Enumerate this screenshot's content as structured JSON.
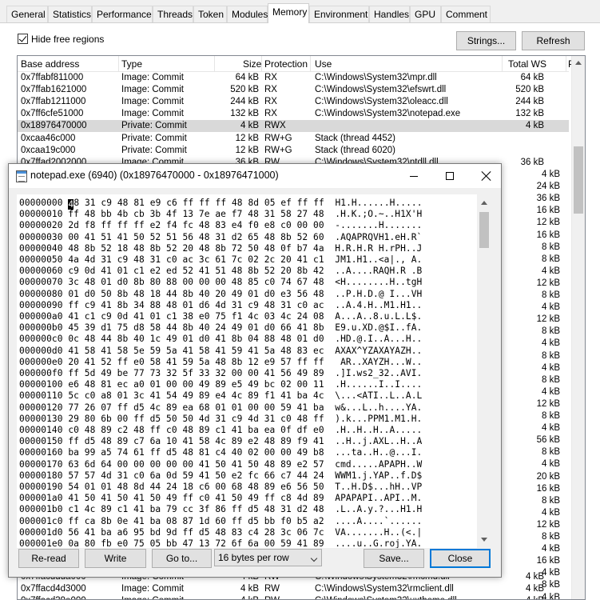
{
  "tabs": [
    "General",
    "Statistics",
    "Performance",
    "Threads",
    "Token",
    "Modules",
    "Memory",
    "Environment",
    "Handles",
    "GPU",
    "Comment"
  ],
  "active_tab": "Memory",
  "hide_free_regions": "Hide free regions",
  "buttons": {
    "strings": "Strings...",
    "refresh": "Refresh"
  },
  "columns": [
    "Base address",
    "Type",
    "Size",
    "Protection",
    "Use",
    "Total WS",
    "P"
  ],
  "rows_top": [
    [
      "0x7ffabf811000",
      "Image: Commit",
      "64 kB",
      "RX",
      "C:\\Windows\\System32\\mpr.dll",
      "64 kB"
    ],
    [
      "0x7ffab1621000",
      "Image: Commit",
      "520 kB",
      "RX",
      "C:\\Windows\\System32\\efswrt.dll",
      "520 kB"
    ],
    [
      "0x7ffab1211000",
      "Image: Commit",
      "244 kB",
      "RX",
      "C:\\Windows\\System32\\oleacc.dll",
      "244 kB"
    ],
    [
      "0x7ff6cfe51000",
      "Image: Commit",
      "132 kB",
      "RX",
      "C:\\Windows\\System32\\notepad.exe",
      "132 kB"
    ],
    [
      "0x18976470000",
      "Private: Commit",
      "4 kB",
      "RWX",
      "",
      "4 kB"
    ],
    [
      "0xcaa46c000",
      "Private: Commit",
      "12 kB",
      "RW+G",
      "Stack (thread 4452)",
      ""
    ],
    [
      "0xcaa19c000",
      "Private: Commit",
      "12 kB",
      "RW+G",
      "Stack (thread 6020)",
      ""
    ],
    [
      "0x7ffad2002000",
      "Image: Commit",
      "36 kB",
      "RW",
      "C:\\Windows\\System32\\ntdll.dll",
      "36 kB"
    ]
  ],
  "right_sizes": [
    "4 kB",
    "24 kB",
    "36 kB",
    "16 kB",
    "12 kB",
    "16 kB",
    "8 kB",
    "8 kB",
    "4 kB",
    "12 kB",
    "8 kB",
    "4 kB",
    "12 kB",
    "8 kB",
    "4 kB",
    "8 kB",
    "4 kB",
    "8 kB",
    "4 kB",
    "12 kB",
    "8 kB",
    "4 kB",
    "56 kB",
    "8 kB",
    "4 kB",
    "20 kB",
    "16 kB",
    "8 kB",
    "4 kB",
    "12 kB",
    "8 kB",
    "4 kB",
    "16 kB",
    "4 kB",
    "8 kB",
    "4 kB",
    "8 kB",
    "12 kB"
  ],
  "rows_bottom": [
    [
      "0x7ffacddda000",
      "Image: Commit",
      "4 kB",
      "RW",
      "C:\\Windows\\System32\\rmcmd.dll",
      "4 kB"
    ],
    [
      "0x7ffacd4d3000",
      "Image: Commit",
      "4 kB",
      "RW",
      "C:\\Windows\\System32\\rmclient.dll",
      "4 kB"
    ],
    [
      "0x7ffacd39e000",
      "Image: Commit",
      "4 kB",
      "RW",
      "C:\\Windows\\System32\\uxtheme.dll",
      "4 kB"
    ]
  ],
  "dialog": {
    "title": "notepad.exe (6940) (0x18976470000 - 0x18976471000)",
    "hex_first_rest": "8 31 c9 48 81 e9 c6 ff ff ff 48 8d 05 ef ff ff  H1.H......H.....",
    "hex_first_prefix": "00000000 ",
    "hex_first_caret": "4",
    "hex_lines": [
      "00000010 ff 48 bb 4b cb 3b 4f 13 7e ae f7 48 31 58 27 48  .H.K.;O.~..H1X'H",
      "00000020 2d f8 ff ff ff e2 f4 fc 48 83 e4 f0 e8 c0 00 00  -.......H.......",
      "00000030 00 41 51 41 50 52 51 56 48 31 d2 65 48 8b 52 60  .AQAPRQVH1.eH.R`",
      "00000040 48 8b 52 18 48 8b 52 20 48 8b 72 50 48 0f b7 4a  H.R.H.R H.rPH..J",
      "00000050 4a 4d 31 c9 48 31 c0 ac 3c 61 7c 02 2c 20 41 c1  JM1.H1..<a|., A.",
      "00000060 c9 0d 41 01 c1 e2 ed 52 41 51 48 8b 52 20 8b 42  ..A....RAQH.R .B",
      "00000070 3c 48 01 d0 8b 80 88 00 00 00 48 85 c0 74 67 48  <H........H..tgH",
      "00000080 01 d0 50 8b 48 18 44 8b 40 20 49 01 d0 e3 56 48  ..P.H.D.@ I...VH",
      "00000090 ff c9 41 8b 34 88 48 01 d6 4d 31 c9 48 31 c0 ac  ..A.4.H..M1.H1..",
      "000000a0 41 c1 c9 0d 41 01 c1 38 e0 75 f1 4c 03 4c 24 08  A...A..8.u.L.L$.",
      "000000b0 45 39 d1 75 d8 58 44 8b 40 24 49 01 d0 66 41 8b  E9.u.XD.@$I..fA.",
      "000000c0 0c 48 44 8b 40 1c 49 01 d0 41 8b 04 88 48 01 d0  .HD.@.I..A...H..",
      "000000d0 41 58 41 58 5e 59 5a 41 58 41 59 41 5a 48 83 ec  AXAX^YZAXAYAZH..",
      "000000e0 20 41 52 ff e0 58 41 59 5a 48 8b 12 e9 57 ff ff   AR..XAYZH...W..",
      "000000f0 ff 5d 49 be 77 73 32 5f 33 32 00 00 41 56 49 89  .]I.ws2_32..AVI.",
      "00000100 e6 48 81 ec a0 01 00 00 49 89 e5 49 bc 02 00 11  .H......I..I....",
      "00000110 5c c0 a8 01 3c 41 54 49 89 e4 4c 89 f1 41 ba 4c  \\...<ATI..L..A.L",
      "00000120 77 26 07 ff d5 4c 89 ea 68 01 01 00 00 59 41 ba  w&...L..h....YA.",
      "00000130 29 80 6b 00 ff d5 50 50 4d 31 c9 4d 31 c0 48 ff  ).k...PPM1.M1.H.",
      "00000140 c0 48 89 c2 48 ff c0 48 89 c1 41 ba ea 0f df e0  .H..H..H..A.....",
      "00000150 ff d5 48 89 c7 6a 10 41 58 4c 89 e2 48 89 f9 41  ..H..j.AXL..H..A",
      "00000160 ba 99 a5 74 61 ff d5 48 81 c4 40 02 00 00 49 b8  ...ta..H..@...I.",
      "00000170 63 6d 64 00 00 00 00 00 41 50 41 50 48 89 e2 57  cmd.....APAPH..W",
      "00000180 57 57 4d 31 c0 6a 0d 59 41 50 e2 fc 66 c7 44 24  WWM1.j.YAP..f.D$",
      "00000190 54 01 01 48 8d 44 24 18 c6 00 68 48 89 e6 56 50  T..H.D$...hH..VP",
      "000001a0 41 50 41 50 41 50 49 ff c0 41 50 49 ff c8 4d 89  APAPAPI..API..M.",
      "000001b0 c1 4c 89 c1 41 ba 79 cc 3f 86 ff d5 48 31 d2 48  .L..A.y.?...H1.H",
      "000001c0 ff ca 8b 0e 41 ba 08 87 1d 60 ff d5 bb f0 b5 a2  ....A....`......",
      "000001d0 56 41 ba a6 95 bd 9d ff d5 48 83 c4 28 3c 06 7c  VA.......H..(<.|",
      "000001e0 0a 80 fb e0 75 05 bb 47 13 72 6f 6a 00 59 41 89  ....u..G.roj.YA."
    ],
    "buttons": {
      "reread": "Re-read",
      "write": "Write",
      "goto": "Go to...",
      "save": "Save...",
      "close": "Close"
    },
    "bytes_per_row": "16 bytes per row"
  }
}
